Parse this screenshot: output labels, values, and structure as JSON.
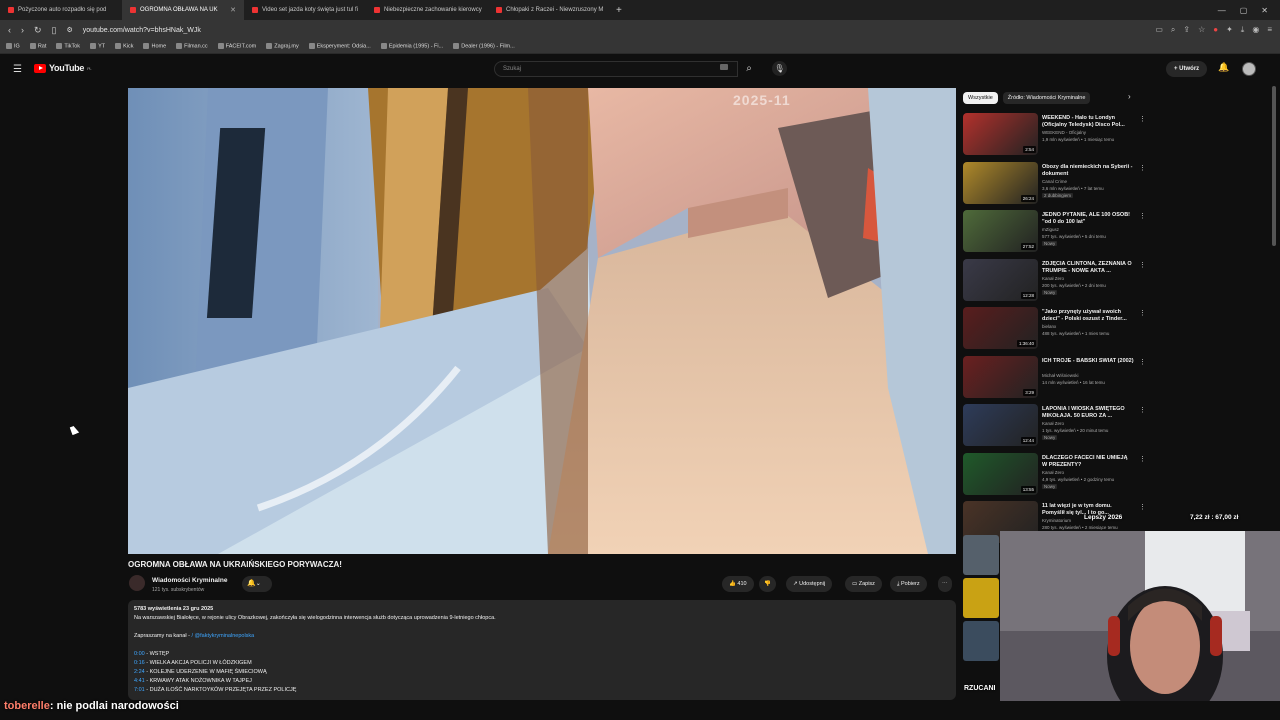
{
  "browser": {
    "tabs": [
      {
        "label": "Pożyczone auto rozpadło się pod",
        "active": false
      },
      {
        "label": "OGROMNA OBŁAWA NA UK",
        "active": true
      },
      {
        "label": "Video set jazda koty święta just tul fi",
        "active": false
      },
      {
        "label": "Niebezpieczne zachowanie kierowcy",
        "active": false
      },
      {
        "label": "Chłopaki z Raczei - Niewzruszony M",
        "active": false
      }
    ],
    "url": "youtube.com/watch?v=bhsHNak_WJk",
    "bookmarks": [
      "IG",
      "Rat",
      "TikTok",
      "YT",
      "Kick",
      "Home",
      "Filman.cc",
      "FACEIT.com",
      "Zagraj.my",
      "Eksperyment: Odsia...",
      "Epidemia (1995) - Fi...",
      "Dealer (1996) - Film..."
    ]
  },
  "youtube": {
    "logo": "YouTube",
    "logo_region": "PL",
    "search_placeholder": "Szukaj",
    "create_label": "+ Utwórz"
  },
  "video": {
    "timestamp_overlay": "2025-11",
    "title": "OGROMNA OBŁAWA NA UKRAIŃSKIEGO PORYWACZA!",
    "channel": "Wiadomości Kryminalne",
    "subscribers": "121 tys. subskrybentów",
    "likes": "410",
    "share": "Udostępnij",
    "save": "Zapisz",
    "download": "Pobierz"
  },
  "description": {
    "stats": "5783 wyświetlenia  23 gru 2025",
    "text": "Na warszawskiej Białołęce, w rejonie ulicy Obrazkowej, zakończyła się wielogodzinna interwencja służb dotycząca uprowadzenia 9-letniego chłopca.",
    "promo_prefix": "Zapraszamy na kanał -",
    "promo_link": "/ @faktykryminalnepolska",
    "chapters": [
      {
        "time": "0:00",
        "label": "- WSTĘP"
      },
      {
        "time": "0:16",
        "label": "- WIELKA AKCJA POLICJI W ŁÓDZKIGEM"
      },
      {
        "time": "2:24",
        "label": "- KOLEJNE UDERZENIE W MAFIĘ ŚMIECIOWĄ"
      },
      {
        "time": "4:41",
        "label": "- KRWAWY ATAK NOŻOWNIKA W TAJPEJ"
      },
      {
        "time": "7:01",
        "label": "- DUŻA ILOŚĆ NARKTOYKÓW PRZEJĘTA PRZEZ POLICJĘ"
      }
    ]
  },
  "chips": [
    "Wszystkie",
    "Źródło: Wiadomości Kryminalne"
  ],
  "recommendations": [
    {
      "title": "WEEKEND - Halo tu Londyn (Oficjalny Teledysk) Disco Pol...",
      "channel": "WEEKEND - Oficjalny",
      "meta": "1,9 mln wyświetleń • 1 miesiąc temu",
      "badge": "",
      "duration": "2:54",
      "thumb": "#b3312c"
    },
    {
      "title": "Obozy dla niemieckich na Syberii - dokument",
      "channel": "Canal Crime",
      "meta": "3,6 mln wyświetleń • 7 lat temu",
      "badge": "2 dubbingiem",
      "duration": "26:24",
      "thumb": "#b08a2a"
    },
    {
      "title": "JEDNO PYTANIE, ALE 100 OSÓB! \"od 0 do 100 lat\"",
      "channel": "mZigusz",
      "meta": "577 tys. wyświetleń • 5 dni temu",
      "badge": "Nowy",
      "duration": "27:52",
      "thumb": "#4f6b3a"
    },
    {
      "title": "ZDJĘCIA CLINTONA, ZEZNANIA O TRUMPIE - NOWE AKTA ...",
      "channel": "Kanał Zero",
      "meta": "200 tys. wyświetleń • 2 dni temu",
      "badge": "Nowy",
      "duration": "12:28",
      "thumb": "#3a3a48"
    },
    {
      "title": "\"Jako przynęty używał swoich dzieci\" - Polski oszust z Tinder...",
      "channel": "bielanx",
      "meta": "488 tys. wyświetleń • 1 mies temu",
      "badge": "",
      "duration": "1:36:40",
      "thumb": "#5a1d1d"
    },
    {
      "title": "ICH TROJE - BABSKI ŚWIAT (2002)",
      "channel": "Michał Wiśniewski",
      "meta": "14 mln wyświetleń • 16 lat temu",
      "badge": "",
      "duration": "3:29",
      "thumb": "#6b2020"
    },
    {
      "title": "LAPONIA I WIOSKA ŚWIĘTEGO MIKOŁAJA. 50 EURO ZA ...",
      "channel": "Kanał Zero",
      "meta": "1 tys. wyświetleń • 20 minut temu",
      "badge": "Nowy",
      "duration": "12:44",
      "thumb": "#2e3c5a"
    },
    {
      "title": "DLACZEGO FACECI NIE UMIEJĄ W PREZENTY?",
      "channel": "Kanał Zero",
      "meta": "4,9 tys. wyświetleń • 2 godziny temu",
      "badge": "Nowy",
      "duration": "13:55",
      "thumb": "#1f5a2a"
    },
    {
      "title": "11 lat więzi je w tym domu. Pomyślił się tyl... I to go...",
      "channel": "Kryminatorium",
      "meta": "280 tys. wyświetleń • 2 miesiące temu",
      "badge": "",
      "duration": "",
      "thumb": "#4a3326"
    }
  ],
  "overlays": {
    "lepszy": "Lepszy 2026",
    "price": "7,22 zł : 67,00 zł",
    "rzucanie": "RZUCANI"
  },
  "chat": {
    "user": "toberelle",
    "message": ": nie podlai narodowości"
  }
}
